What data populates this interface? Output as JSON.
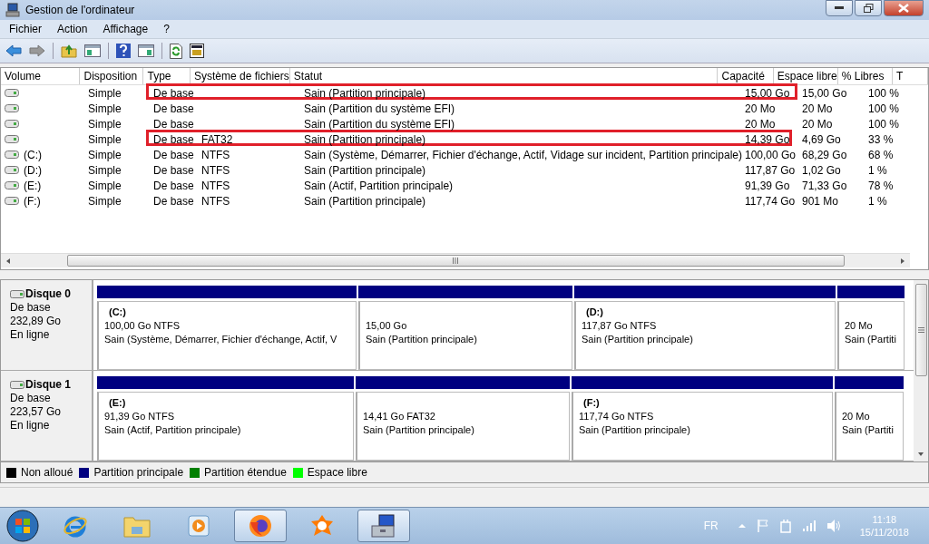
{
  "window": {
    "title": "Gestion de l'ordinateur"
  },
  "menu": [
    "Fichier",
    "Action",
    "Affichage",
    "?"
  ],
  "table": {
    "columns": [
      "Volume",
      "Disposition",
      "Type",
      "Système de fichiers",
      "Statut",
      "Capacité",
      "Espace libre",
      "% Libres",
      "T"
    ],
    "rows": [
      {
        "layout": "Simple",
        "type": "De base",
        "status": "Sain (Partition principale)",
        "capacity": "15,00 Go",
        "free": "15,00 Go",
        "pct": "100 %",
        "highlighted": true
      },
      {
        "layout": "Simple",
        "type": "De base",
        "status": "Sain (Partition du système EFI)",
        "capacity": "20 Mo",
        "free": "20 Mo",
        "pct": "100 %",
        "highlighted": false
      },
      {
        "layout": "Simple",
        "type": "De base",
        "status": "Sain (Partition du système EFI)",
        "capacity": "20 Mo",
        "free": "20 Mo",
        "pct": "100 %",
        "highlighted": false
      },
      {
        "layout": "Simple",
        "type": "De base",
        "fs": "FAT32",
        "status": "Sain (Partition principale)",
        "capacity": "14,39 Go",
        "free": "4,69 Go",
        "pct": "33 %",
        "highlighted": true
      },
      {
        "volume": "(C:)",
        "layout": "Simple",
        "type": "De base",
        "fs": "NTFS",
        "status": "Sain (Système, Démarrer, Fichier d'échange, Actif, Vidage sur incident, Partition principale)",
        "capacity": "100,00 Go",
        "free": "68,29 Go",
        "pct": "68 %",
        "highlighted": false
      },
      {
        "volume": "(D:)",
        "layout": "Simple",
        "type": "De base",
        "fs": "NTFS",
        "status": "Sain (Partition principale)",
        "capacity": "117,87 Go",
        "free": "1,02 Go",
        "pct": "1 %",
        "highlighted": false
      },
      {
        "volume": "(E:)",
        "layout": "Simple",
        "type": "De base",
        "fs": "NTFS",
        "status": "Sain (Actif, Partition principale)",
        "capacity": "91,39 Go",
        "free": "71,33 Go",
        "pct": "78 %",
        "highlighted": false
      },
      {
        "volume": "(F:)",
        "layout": "Simple",
        "type": "De base",
        "fs": "NTFS",
        "status": "Sain (Partition principale)",
        "capacity": "117,74 Go",
        "free": "901 Mo",
        "pct": "1 %",
        "highlighted": false
      }
    ]
  },
  "disks": [
    {
      "name": "Disque 0",
      "kind_text": "De base",
      "size": "232,89 Go",
      "state": "En ligne",
      "partitions": [
        {
          "kind": "primary",
          "letter": "(C:)",
          "size": "100,00 Go NTFS",
          "status": "Sain (Système, Démarrer, Fichier d'échange, Actif, V"
        },
        {
          "kind": "primary",
          "size": "15,00 Go",
          "status": "Sain (Partition principale)"
        },
        {
          "kind": "primary",
          "letter": "(D:)",
          "size": "117,87 Go NTFS",
          "status": "Sain (Partition principale)"
        },
        {
          "kind": "primary",
          "size": "20 Mo",
          "status": "Sain (Partiti"
        }
      ]
    },
    {
      "name": "Disque 1",
      "kind_text": "De base",
      "size": "223,57 Go",
      "state": "En ligne",
      "partitions": [
        {
          "kind": "primary",
          "letter": "(E:)",
          "size": "91,39 Go NTFS",
          "status": "Sain (Actif, Partition principale)"
        },
        {
          "kind": "primary",
          "size": "14,41 Go FAT32",
          "status": "Sain (Partition principale)"
        },
        {
          "kind": "primary",
          "letter": "(F:)",
          "size": "117,74 Go NTFS",
          "status": "Sain (Partition principale)"
        },
        {
          "kind": "primary",
          "size": "20 Mo",
          "status": "Sain (Partiti"
        }
      ]
    }
  ],
  "legend": [
    {
      "label": "Non alloué",
      "color": "#000000"
    },
    {
      "label": "Partition principale",
      "color": "#000080"
    },
    {
      "label": "Partition étendue",
      "color": "#008000"
    },
    {
      "label": "Espace libre",
      "color": "#00ff00"
    }
  ],
  "taskbar": {
    "apps": [
      {
        "kind": "ie",
        "selected": false
      },
      {
        "kind": "explorer",
        "selected": false
      },
      {
        "kind": "media",
        "selected": false
      },
      {
        "kind": "firefox",
        "selected": true
      },
      {
        "kind": "avast",
        "selected": false
      },
      {
        "kind": "management",
        "selected": true
      }
    ],
    "language": "FR",
    "time": "11:18",
    "date": "15/11/2018"
  }
}
